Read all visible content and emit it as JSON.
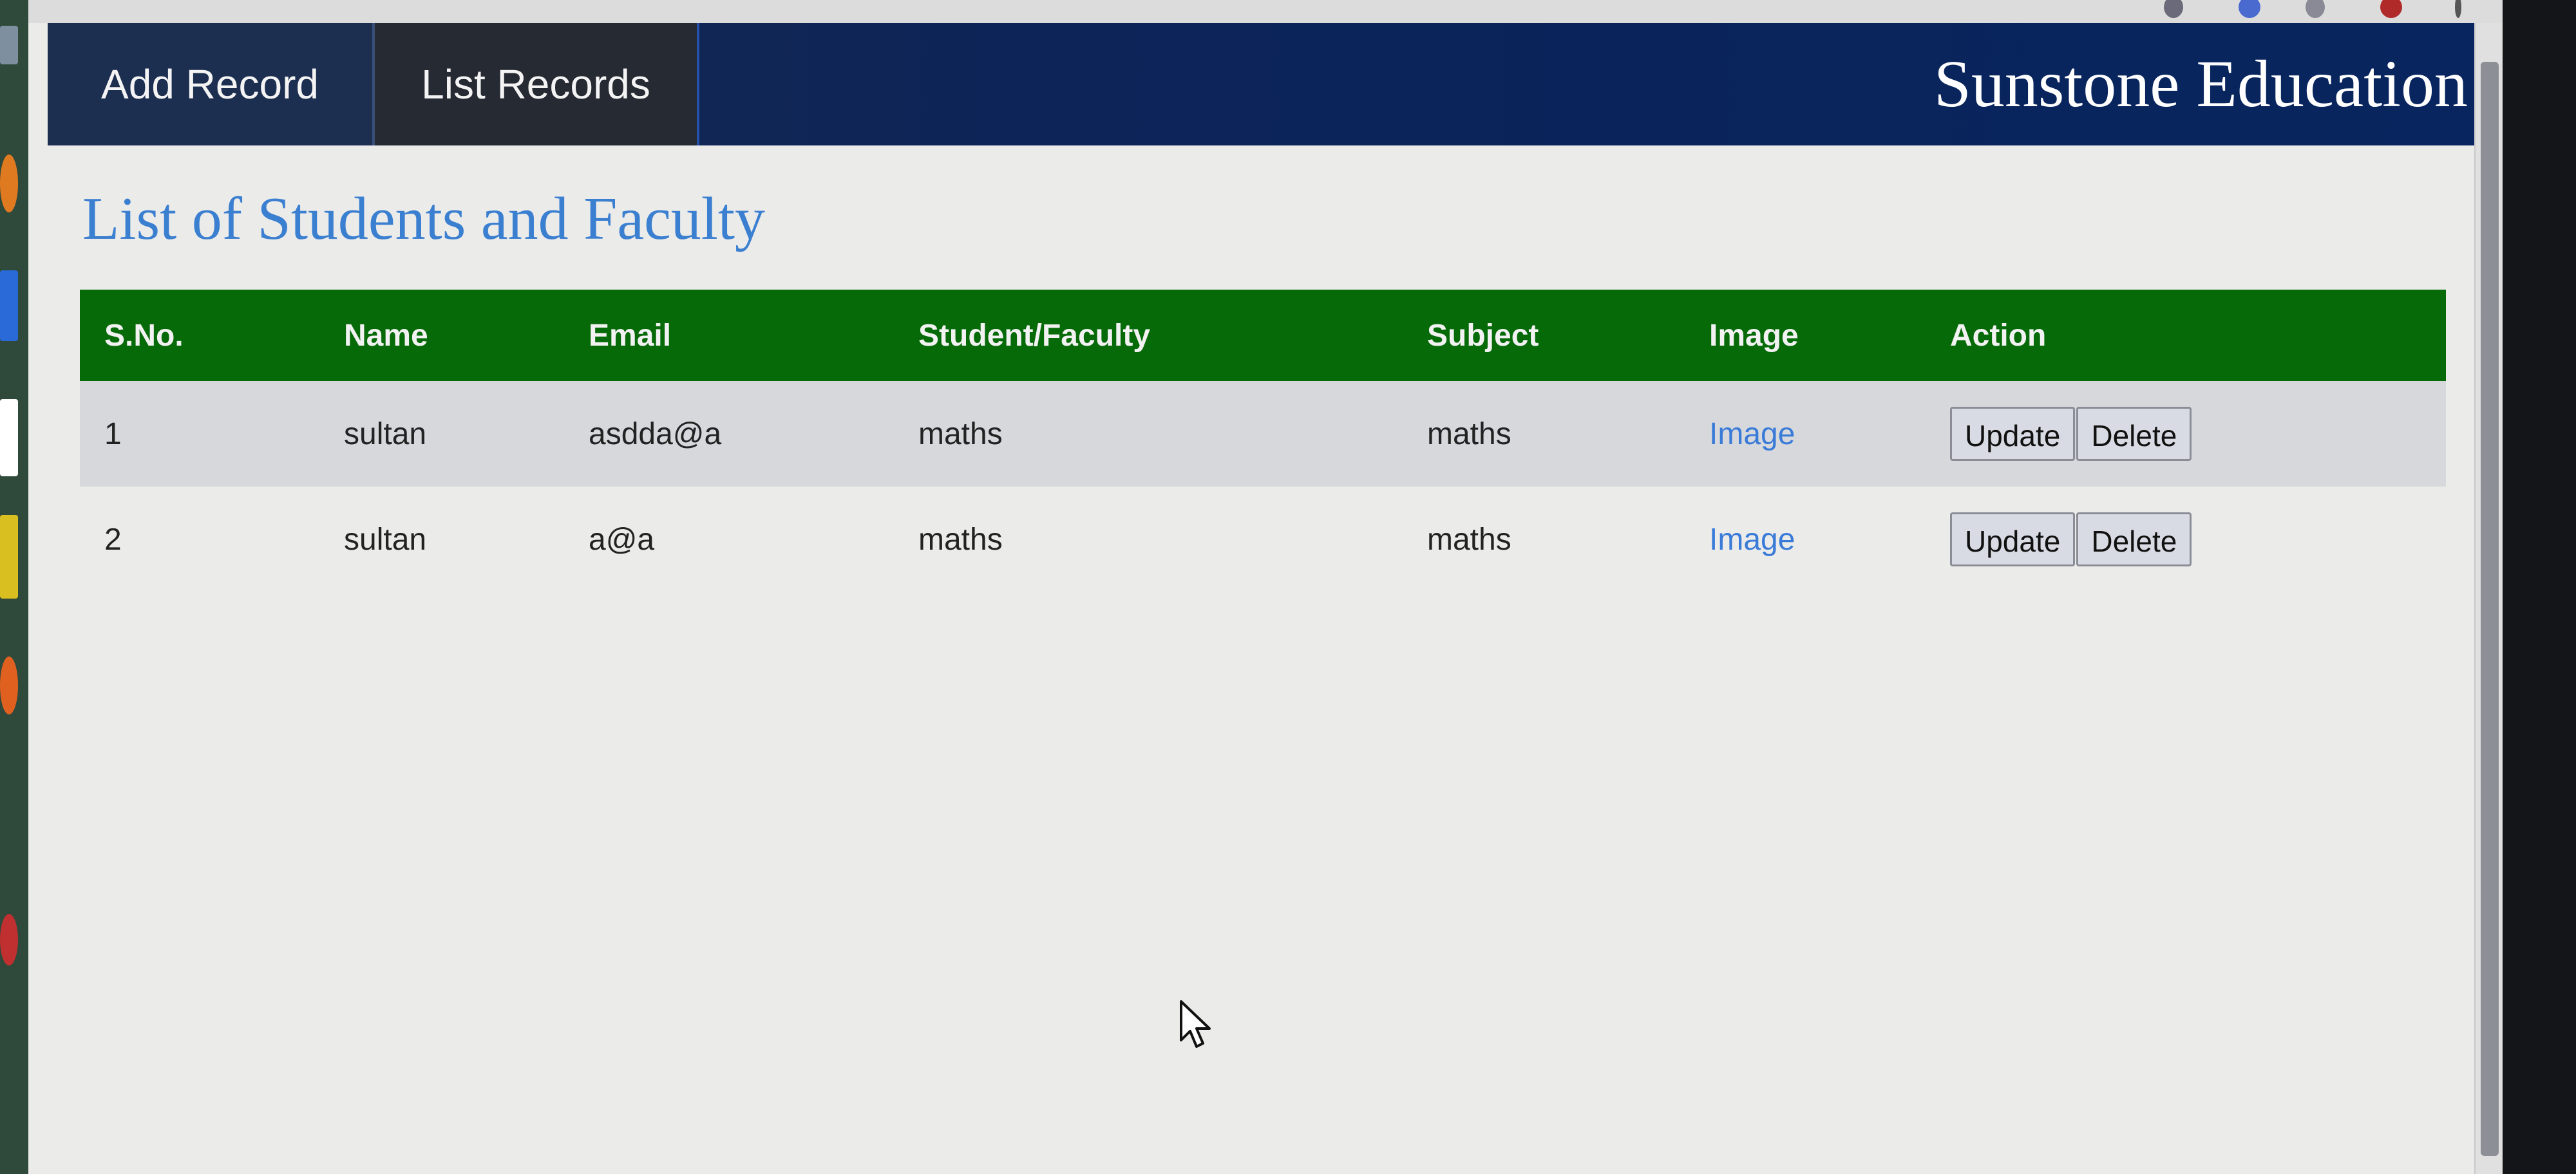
{
  "nav": {
    "tabs": [
      {
        "label": "Add Record"
      },
      {
        "label": "List Records"
      }
    ],
    "brand": "Sunstone Education"
  },
  "main": {
    "title": "List of Students and Faculty",
    "table": {
      "headers": [
        "S.No.",
        "Name",
        "Email",
        "Student/Faculty",
        "Subject",
        "Image",
        "Action"
      ],
      "rows": [
        {
          "sno": "1",
          "name": "sultan",
          "email": "asdda@a",
          "type": "maths",
          "subject": "maths",
          "image": "Image",
          "update": "Update",
          "delete": "Delete"
        },
        {
          "sno": "2",
          "name": "sultan",
          "email": "a@a",
          "type": "maths",
          "subject": "maths",
          "image": "Image",
          "update": "Update",
          "delete": "Delete"
        }
      ]
    }
  },
  "colors": {
    "navbar": "#0c2458",
    "header_row": "#066a08",
    "title": "#3b7fd0",
    "link": "#3a7bd8"
  },
  "icons": [
    "mouse-cursor-icon"
  ]
}
